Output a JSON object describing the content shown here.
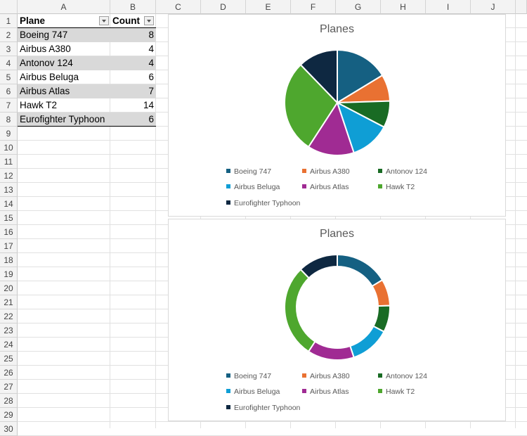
{
  "columns": [
    "A",
    "B",
    "C",
    "D",
    "E",
    "F",
    "G",
    "H",
    "I",
    "J"
  ],
  "rows": [
    "1",
    "2",
    "3",
    "4",
    "5",
    "6",
    "7",
    "8",
    "9",
    "10",
    "11",
    "12",
    "13",
    "14",
    "15",
    "16",
    "17",
    "18",
    "19",
    "20",
    "21",
    "22",
    "23",
    "24",
    "25",
    "26",
    "27",
    "28",
    "29",
    "30"
  ],
  "table": {
    "headers": [
      "Plane",
      "Count"
    ],
    "rows": [
      {
        "plane": "Boeing 747",
        "count": "8"
      },
      {
        "plane": "Airbus A380",
        "count": "4"
      },
      {
        "plane": "Antonov 124",
        "count": "4"
      },
      {
        "plane": "Airbus Beluga",
        "count": "6"
      },
      {
        "plane": "Airbus Atlas",
        "count": "7"
      },
      {
        "plane": "Hawk T2",
        "count": "14"
      },
      {
        "plane": "Eurofighter Typhoon",
        "count": "6"
      }
    ]
  },
  "chart_data": [
    {
      "type": "pie",
      "title": "Planes",
      "categories": [
        "Boeing 747",
        "Airbus A380",
        "Antonov 124",
        "Airbus Beluga",
        "Airbus Atlas",
        "Hawk T2",
        "Eurofighter Typhoon"
      ],
      "values": [
        8,
        4,
        4,
        6,
        7,
        14,
        6
      ],
      "colors": [
        "#156082",
        "#E97132",
        "#196B24",
        "#0F9ED5",
        "#A02B93",
        "#4EA72E",
        "#0E2841"
      ],
      "legend": "bottom"
    },
    {
      "type": "doughnut",
      "title": "Planes",
      "categories": [
        "Boeing 747",
        "Airbus A380",
        "Antonov 124",
        "Airbus Beluga",
        "Airbus Atlas",
        "Hawk T2",
        "Eurofighter Typhoon"
      ],
      "values": [
        8,
        4,
        4,
        6,
        7,
        14,
        6
      ],
      "colors": [
        "#156082",
        "#E97132",
        "#196B24",
        "#0F9ED5",
        "#A02B93",
        "#4EA72E",
        "#0E2841"
      ],
      "legend": "bottom"
    }
  ]
}
